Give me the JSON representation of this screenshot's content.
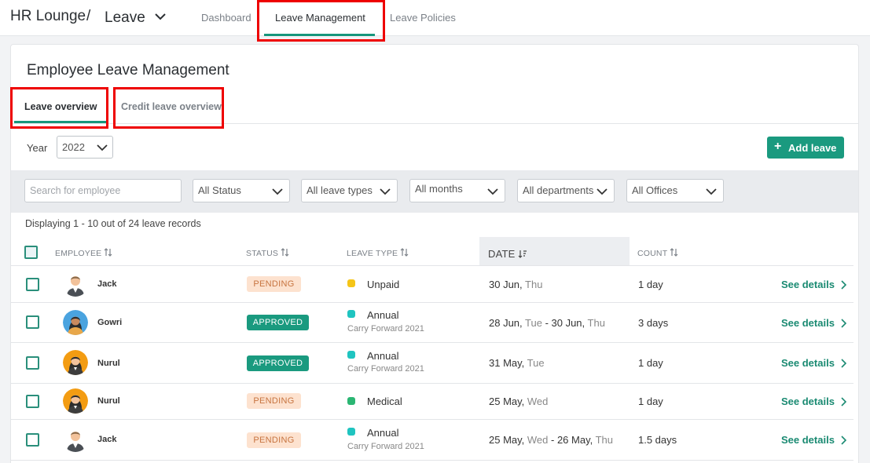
{
  "topbar": {
    "brand": "HR Lounge",
    "separator": "/",
    "app_name": "Leave",
    "tabs": [
      {
        "label": "Dashboard"
      },
      {
        "label": "Leave Management"
      },
      {
        "label": "Leave Policies"
      }
    ],
    "active_tab": "Leave Management"
  },
  "page": {
    "title": "Employee Leave Management",
    "subtabs": [
      {
        "label": "Leave overview"
      },
      {
        "label": "Credit leave overview"
      }
    ],
    "active_subtab": "Leave overview"
  },
  "toolbar": {
    "year_label": "Year",
    "year_value": "2022",
    "add_button": "Add leave",
    "add_icon": "+"
  },
  "filters": {
    "search_placeholder": "Search for employee",
    "status": "All Status",
    "leave_types": "All leave types",
    "months": "All months",
    "departments": "All departments",
    "offices": "All Offices"
  },
  "display_info": "Displaying 1 - 10 out of 24 leave records",
  "table": {
    "columns": {
      "employee": "EMPLOYEE",
      "status": "STATUS",
      "leave_type": "LEAVE TYPE",
      "date": "DATE",
      "count": "COUNT"
    },
    "rows": [
      {
        "name": "Jack",
        "avatar": "man-avatar",
        "status": "PENDING",
        "leave_type": "Unpaid",
        "leave_color": "#f5c518",
        "sub": "",
        "date_a": "30 Jun, ",
        "wd_a": "Thu",
        "date_b": "",
        "wd_b": "",
        "count": "1 day",
        "action": "See details"
      },
      {
        "name": "Gowri",
        "avatar": "woman-avatar-blue",
        "status": "APPROVED",
        "leave_type": "Annual",
        "leave_color": "#1fc4c0",
        "sub": "Carry Forward 2021",
        "date_a": "28 Jun, ",
        "wd_a": "Tue",
        "date_b": " - 30 Jun, ",
        "wd_b": "Thu",
        "count": "3 days",
        "action": "See details"
      },
      {
        "name": "Nurul",
        "avatar": "woman-avatar-orange",
        "status": "APPROVED",
        "leave_type": "Annual",
        "leave_color": "#1fc4c0",
        "sub": "Carry Forward 2021",
        "date_a": "31 May, ",
        "wd_a": "Tue",
        "date_b": "",
        "wd_b": "",
        "count": "1 day",
        "action": "See details"
      },
      {
        "name": "Nurul",
        "avatar": "woman-avatar-orange",
        "status": "PENDING",
        "leave_type": "Medical",
        "leave_color": "#2bb673",
        "sub": "",
        "date_a": "25 May, ",
        "wd_a": "Wed",
        "date_b": "",
        "wd_b": "",
        "count": "1 day",
        "action": "See details"
      },
      {
        "name": "Jack",
        "avatar": "man-avatar",
        "status": "PENDING",
        "leave_type": "Annual",
        "leave_color": "#1fc4c0",
        "sub": "Carry Forward 2021",
        "date_a": "25 May, ",
        "wd_a": "Wed",
        "date_b": " - 26 May, ",
        "wd_b": "Thu",
        "count": "1.5 days",
        "action": "See details"
      }
    ]
  },
  "colors": {
    "accent": "#16967c",
    "highlight": "#e00000",
    "pending_bg": "#fde2cf",
    "pending_text": "#c77440"
  }
}
